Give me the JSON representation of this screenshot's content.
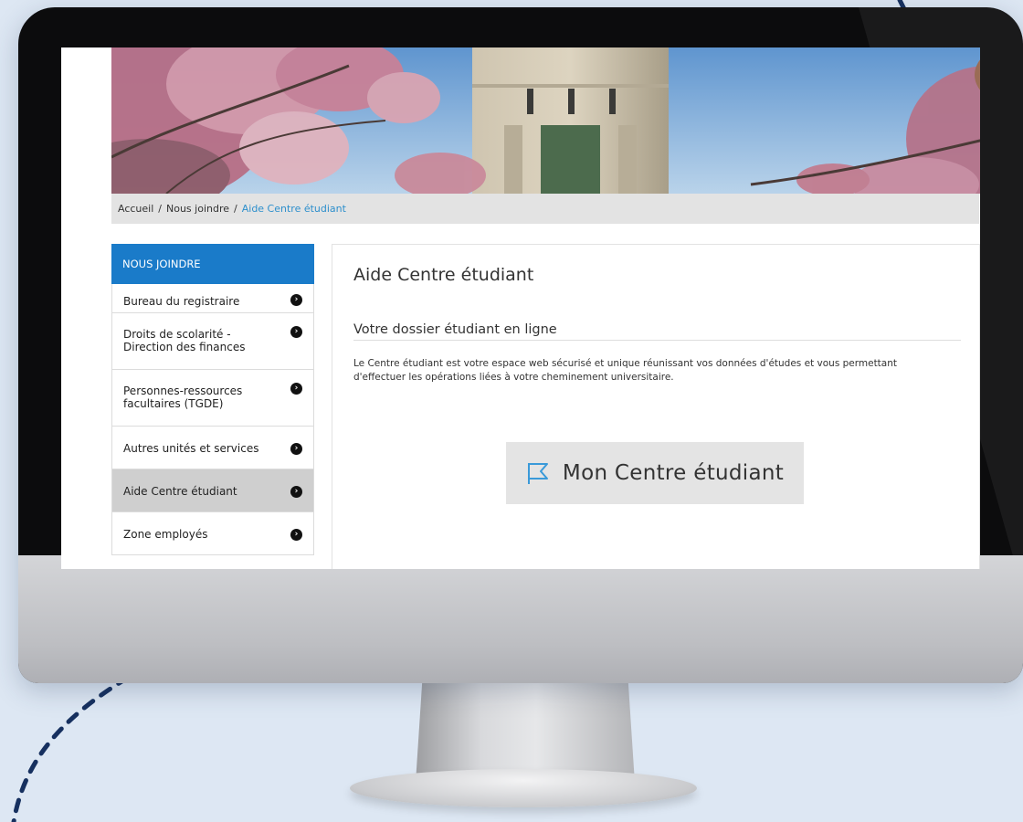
{
  "breadcrumb": {
    "items": [
      "Accueil",
      "Nous joindre"
    ],
    "separator": "/",
    "current": "Aide Centre étudiant"
  },
  "sidebar": {
    "heading": "NOUS JOINDRE",
    "items": [
      {
        "label": "Bureau du registraire",
        "active": false
      },
      {
        "label": "Droits de scolarité - Direction des finances",
        "active": false
      },
      {
        "label": "Personnes-ressources facultaires (TGDE)",
        "active": false
      },
      {
        "label": "Autres unités et services",
        "active": false
      },
      {
        "label": "Aide Centre étudiant",
        "active": true
      },
      {
        "label": "Zone employés",
        "active": false
      }
    ],
    "chevron_icon": "circle-chevron-right-icon"
  },
  "main": {
    "title": "Aide Centre étudiant",
    "section_title": "Votre dossier étudiant en ligne",
    "paragraph": "Le Centre étudiant est votre espace web sécurisé et unique réunissant vos données d'études et vous permettant d'effectuer les opérations liées à votre cheminement universitaire.",
    "cta_label": "Mon Centre étudiant",
    "cta_icon": "flag-icon"
  },
  "colors": {
    "accent": "#1a7bc9",
    "link": "#2d8fcc",
    "page_background": "#dde7f3",
    "active_item": "#cfcfcf"
  }
}
